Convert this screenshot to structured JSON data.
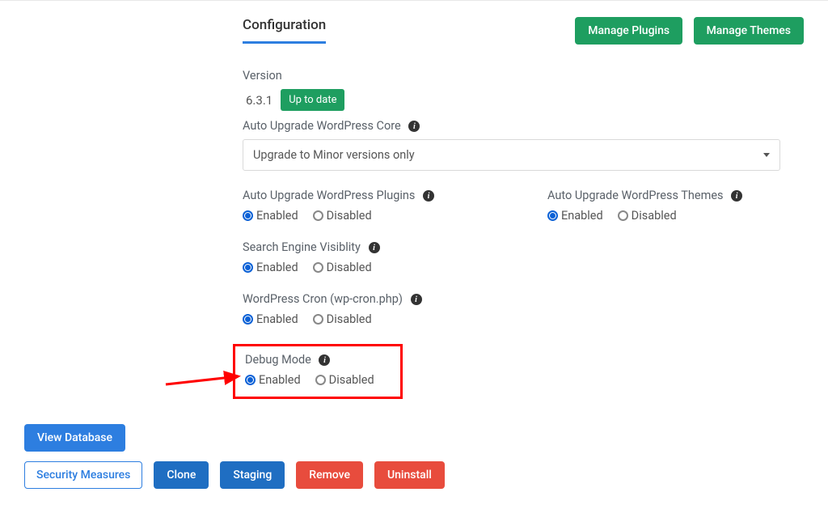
{
  "header": {
    "tab_label": "Configuration",
    "manage_plugins": "Manage Plugins",
    "manage_themes": "Manage Themes"
  },
  "version": {
    "label": "Version",
    "value": "6.3.1",
    "status": "Up to date"
  },
  "auto_upgrade_core": {
    "label": "Auto Upgrade WordPress Core",
    "selected": "Upgrade to Minor versions only"
  },
  "radio_common": {
    "enabled": "Enabled",
    "disabled": "Disabled"
  },
  "auto_upgrade_plugins": {
    "label": "Auto Upgrade WordPress Plugins"
  },
  "auto_upgrade_themes": {
    "label": "Auto Upgrade WordPress Themes"
  },
  "search_visibility": {
    "label": "Search Engine Visiblity"
  },
  "wp_cron": {
    "label": "WordPress Cron (wp-cron.php)"
  },
  "debug_mode": {
    "label": "Debug Mode"
  },
  "buttons": {
    "view_database": "View Database",
    "security_measures": "Security Measures",
    "clone": "Clone",
    "staging": "Staging",
    "remove": "Remove",
    "uninstall": "Uninstall"
  }
}
